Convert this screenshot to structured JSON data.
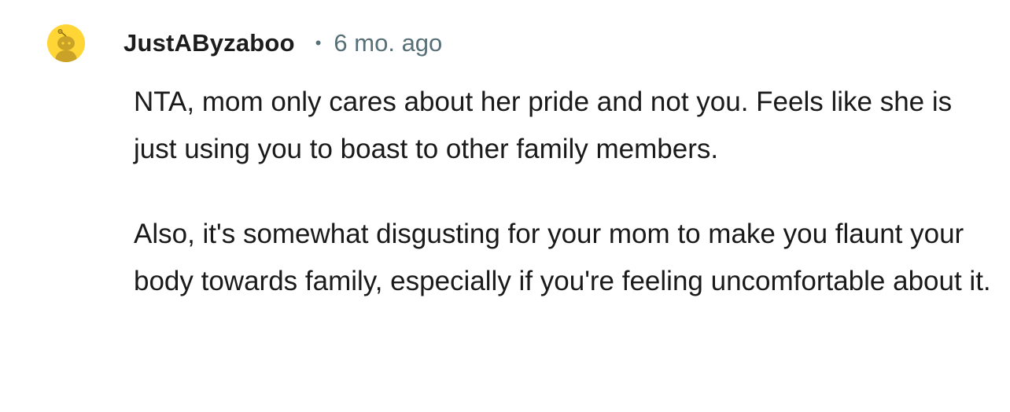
{
  "comment": {
    "avatar_icon": "snoo-avatar-icon",
    "username": "JustAByzaboo",
    "separator": "•",
    "timestamp": "6 mo. ago",
    "paragraphs": [
      "NTA, mom only cares about her pride and not you. Feels like she is just using you to boast to other family members.",
      "Also, it's somewhat disgusting for your mom to make you flaunt your body towards family, especially if you're feeling uncomfortable about it."
    ]
  },
  "colors": {
    "avatar_bg": "#ffd635",
    "avatar_figure": "#c9a227",
    "username": "#1c1c1c",
    "meta": "#576f76",
    "text": "#1a1a1b"
  }
}
